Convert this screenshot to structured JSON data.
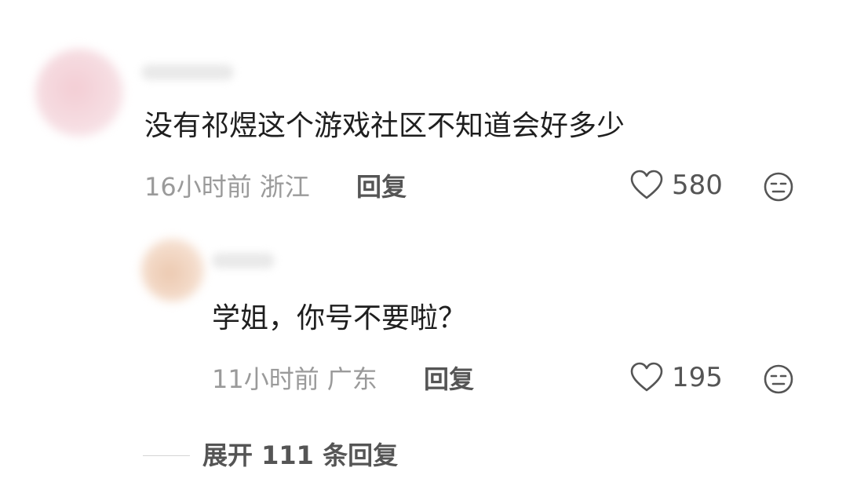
{
  "comment": {
    "text": "没有祁煜这个游戏社区不知道会好多少",
    "time": "16小时前",
    "location": "浙江",
    "reply_label": "回复",
    "likes": "580",
    "avatar_icon": "avatar-blurred",
    "like_icon": "heart-outline-icon",
    "emoji_icon": "neutral-face-icon"
  },
  "reply": {
    "text": "学姐，你号不要啦？",
    "time": "11小时前",
    "location": "广东",
    "reply_label": "回复",
    "likes": "195",
    "avatar_icon": "avatar-blurred",
    "like_icon": "heart-outline-icon",
    "emoji_icon": "neutral-face-icon"
  },
  "expand": {
    "label": "展开 111 条回复"
  },
  "colors": {
    "text_primary": "#1e1e1e",
    "text_meta": "#9a9a9a",
    "action_text": "#555555"
  }
}
